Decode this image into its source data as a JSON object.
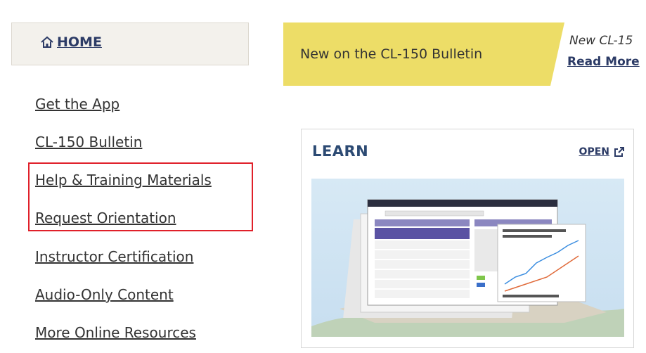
{
  "sidebar": {
    "home_label": "HOME",
    "items": [
      {
        "label": "Get the App"
      },
      {
        "label": "CL-150 Bulletin"
      },
      {
        "label": "Help & Training Materials"
      },
      {
        "label": "Request Orientation"
      },
      {
        "label": "Instructor Certification"
      },
      {
        "label": "Audio-Only Content"
      },
      {
        "label": "More Online Resources"
      }
    ]
  },
  "bulletin": {
    "label": "New on the CL-150 Bulletin",
    "news_text": "New CL-15",
    "read_more": "Read More"
  },
  "learn": {
    "title": "LEARN",
    "open_label": "OPEN"
  },
  "colors": {
    "highlight": "#e0202a",
    "banner": "#eddd67",
    "link": "#2c3b66"
  },
  "icons": [
    "home-icon",
    "external-link-icon"
  ]
}
